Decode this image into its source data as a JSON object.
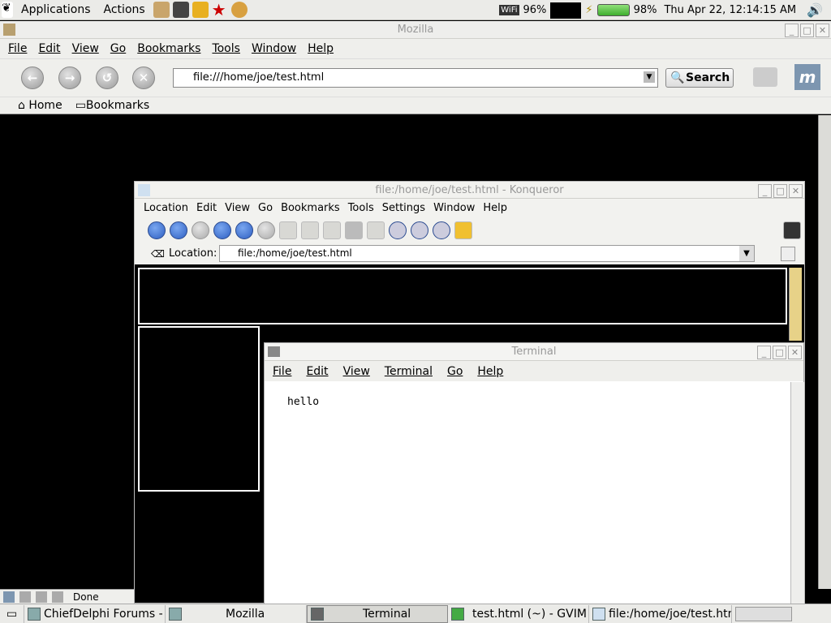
{
  "top_panel": {
    "menus": [
      "Applications",
      "Actions"
    ],
    "wifi_percent": "96%",
    "battery_percent": "98%",
    "clock": "Thu Apr 22, 12:14:15 AM"
  },
  "mozilla": {
    "title": "Mozilla",
    "menu": [
      "File",
      "Edit",
      "View",
      "Go",
      "Bookmarks",
      "Tools",
      "Window",
      "Help"
    ],
    "url": "file:///home/joe/test.html",
    "search_label": "Search",
    "bookmarks_bar": [
      "Home",
      "Bookmarks"
    ],
    "status": "Done"
  },
  "konqueror": {
    "title": "file:/home/joe/test.html - Konqueror",
    "menu": [
      "Location",
      "Edit",
      "View",
      "Go",
      "Bookmarks",
      "Tools",
      "Settings",
      "Window",
      "Help"
    ],
    "location_label": "Location:",
    "url": "file:/home/joe/test.html"
  },
  "terminal": {
    "title": "Terminal",
    "menu": [
      "File",
      "Edit",
      "View",
      "Terminal",
      "Go",
      "Help"
    ],
    "output": "hello"
  },
  "taskbar": {
    "tasks": [
      "ChiefDelphi Forums - An",
      "Mozilla",
      "Terminal",
      "test.html (~) - GVIM",
      "file:/home/joe/test.html -"
    ]
  }
}
